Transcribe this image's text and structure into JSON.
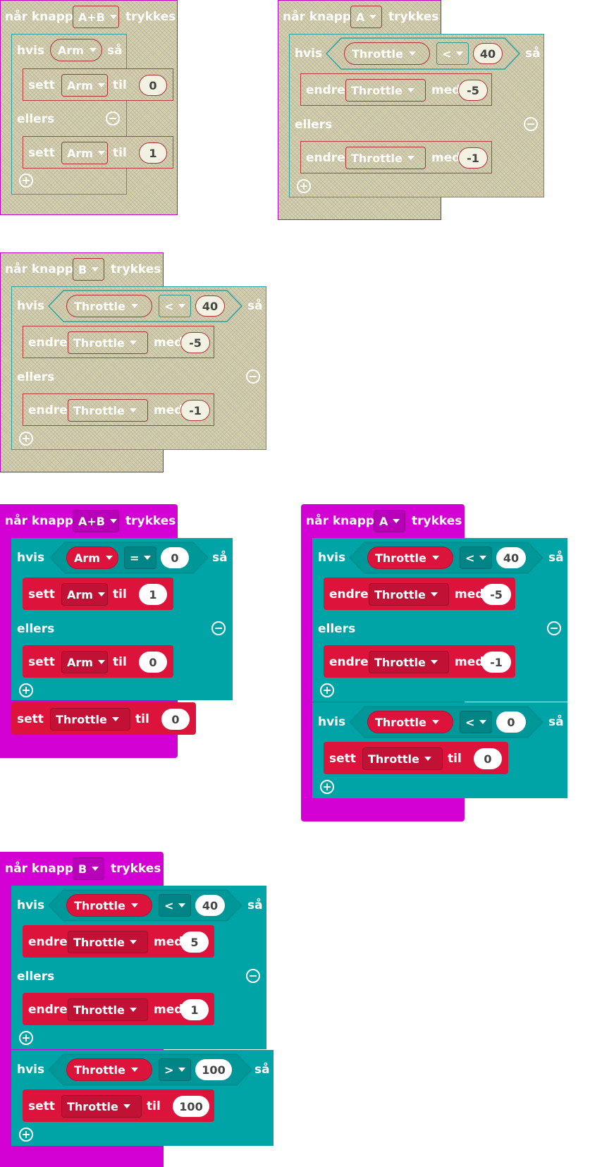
{
  "labels": {
    "when": "når knapp",
    "pressed": "trykkes",
    "if": "hvis",
    "then": "så",
    "else": "ellers",
    "set": "sett",
    "to": "til",
    "change": "endre",
    "by": "med"
  },
  "programs": {
    "p1": {
      "button": "A+B",
      "cond_var": "Arm",
      "set1_var": "Arm",
      "set1_val": "0",
      "set2_var": "Arm",
      "set2_val": "1"
    },
    "p2": {
      "button": "A",
      "cond_var": "Throttle",
      "cond_op": "<",
      "cond_val": "40",
      "ch1_var": "Throttle",
      "ch1_val": "-5",
      "ch2_var": "Throttle",
      "ch2_val": "-1"
    },
    "p3": {
      "button": "B",
      "cond_var": "Throttle",
      "cond_op": "<",
      "cond_val": "40",
      "ch1_var": "Throttle",
      "ch1_val": "-5",
      "ch2_var": "Throttle",
      "ch2_val": "-1"
    },
    "p4": {
      "button": "A+B",
      "cond_var": "Arm",
      "cond_op": "=",
      "cond_val": "0",
      "set1_var": "Arm",
      "set1_val": "1",
      "set2_var": "Arm",
      "set2_val": "0",
      "set3_var": "Throttle",
      "set3_val": "0"
    },
    "p5": {
      "button": "A",
      "cond_var": "Throttle",
      "cond_op": "<",
      "cond_val": "40",
      "ch1_var": "Throttle",
      "ch1_val": "-5",
      "ch2_var": "Throttle",
      "ch2_val": "-1",
      "cond2_var": "Throttle",
      "cond2_op": "<",
      "cond2_val": "0",
      "set_var": "Throttle",
      "set_val": "0"
    },
    "p6": {
      "button": "B",
      "cond_var": "Throttle",
      "cond_op": "<",
      "cond_val": "40",
      "ch1_var": "Throttle",
      "ch1_val": "5",
      "ch2_var": "Throttle",
      "ch2_val": "1",
      "cond2_var": "Throttle",
      "cond2_op": ">",
      "cond2_val": "100",
      "set_var": "Throttle",
      "set_val": "100"
    }
  },
  "colors": {
    "event": "#d300d3",
    "logic": "#00a4a6",
    "variable": "#dc143c",
    "disabled_base": "#d4d2a6"
  }
}
